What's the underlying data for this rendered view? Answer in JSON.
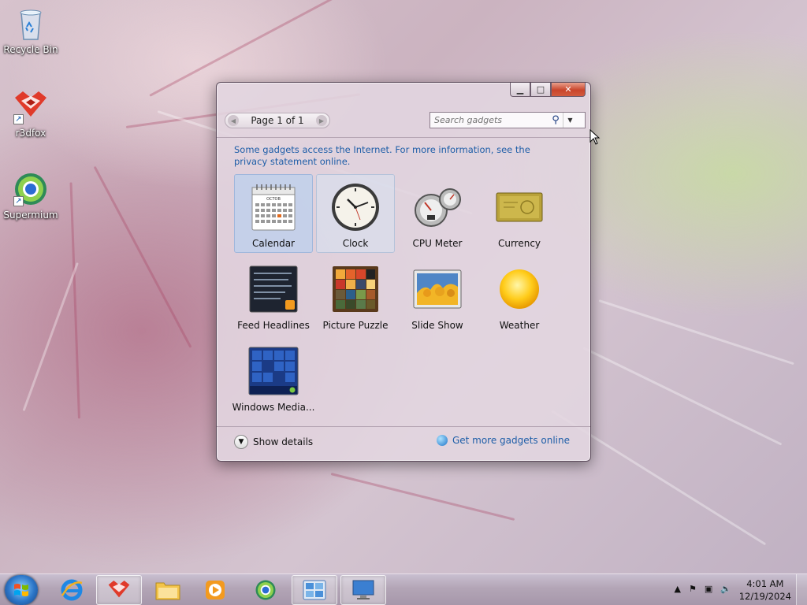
{
  "desktop": {
    "icons": [
      {
        "label": "Recycle Bin",
        "icon": "recycle-bin-icon"
      },
      {
        "label": "r3dfox",
        "icon": "r3dfox-icon"
      },
      {
        "label": "Supermium",
        "icon": "supermium-icon"
      }
    ]
  },
  "gadget_window": {
    "pager_label": "Page 1 of 1",
    "search_placeholder": "Search gadgets",
    "info_text": "Some gadgets access the Internet.  For more information, see the privacy statement online.",
    "gadgets": [
      {
        "name": "Calendar",
        "icon": "calendar-icon",
        "state": "selected"
      },
      {
        "name": "Clock",
        "icon": "clock-icon",
        "state": "hover"
      },
      {
        "name": "CPU Meter",
        "icon": "cpu-meter-icon",
        "state": "normal"
      },
      {
        "name": "Currency",
        "icon": "currency-icon",
        "state": "normal"
      },
      {
        "name": "Feed Headlines",
        "icon": "feed-headlines-icon",
        "state": "normal"
      },
      {
        "name": "Picture Puzzle",
        "icon": "picture-puzzle-icon",
        "state": "normal"
      },
      {
        "name": "Slide Show",
        "icon": "slide-show-icon",
        "state": "normal"
      },
      {
        "name": "Weather",
        "icon": "weather-icon",
        "state": "normal"
      },
      {
        "name": "Windows Media...",
        "icon": "windows-media-icon",
        "state": "normal"
      }
    ],
    "show_details_label": "Show details",
    "get_more_label": "Get more gadgets online",
    "calendar_month": "OCTOB"
  },
  "taskbar": {
    "time": "4:01 AM",
    "date": "12/19/2024",
    "buttons": [
      "start-button",
      "internet-explorer",
      "r3dfox",
      "file-explorer",
      "media-player",
      "supermium",
      "gadgets",
      "desktop-window"
    ]
  },
  "colors": {
    "link": "#1e5ea8",
    "close_button": "#c9452b",
    "selection": "#bcd0ee"
  }
}
